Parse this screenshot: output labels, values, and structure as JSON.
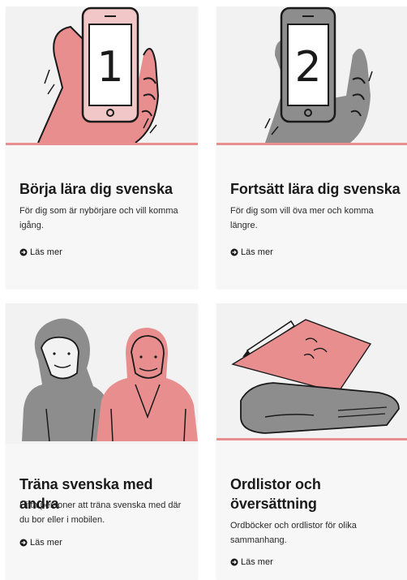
{
  "cards": [
    {
      "illustration": "hand-holding-phone-number-1",
      "phone_number": "1",
      "title": "Börja lära dig svenska",
      "description": "För dig som är nybörjare och vill komma igång.",
      "link": "Läs mer",
      "accent": "#e88e8e"
    },
    {
      "illustration": "hand-holding-phone-number-2",
      "phone_number": "2",
      "title": "Fortsätt lära dig svenska",
      "description": "För dig som vill öva mer och komma längre.",
      "link": "Läs mer",
      "accent": "#e88e8e"
    },
    {
      "illustration": "two-people-portrait",
      "title": "Träna svenska med andra",
      "description": "Hitta personer att träna svenska med där du bor eller i mobilen.",
      "link": "Läs mer",
      "accent": "#e88e8e"
    },
    {
      "illustration": "paper-pen-and-book",
      "title": "Ordlistor och översättning",
      "description": "Ordböcker och ordlistor för olika sammanhang.",
      "link": "Läs mer",
      "accent": "#e88e8e"
    }
  ],
  "colors": {
    "pink": "#e88e8e",
    "gray": "#8d8d8d",
    "ink": "#1a1a1a",
    "card_bg": "#f7f7f7"
  }
}
